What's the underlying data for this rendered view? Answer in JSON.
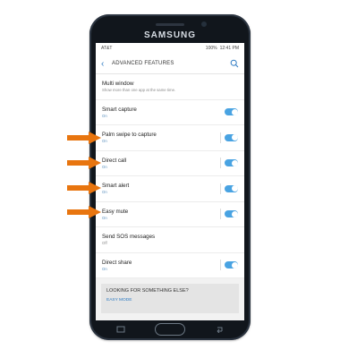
{
  "device": {
    "brand": "SAMSUNG"
  },
  "status_bar": {
    "carrier": "AT&T",
    "battery": "100%",
    "time": "12:41 PM"
  },
  "app_bar": {
    "title": "ADVANCED FEATURES",
    "back_icon": "back-arrow-icon",
    "search_icon": "search-icon"
  },
  "settings": [
    {
      "title": "Multi window",
      "subtitle": "Show more than one app at the same time.",
      "toggle": null
    },
    {
      "title": "Smart capture",
      "subtitle": "On",
      "toggle": true
    },
    {
      "title": "Palm swipe to capture",
      "subtitle": "On",
      "toggle": true
    },
    {
      "title": "Direct call",
      "subtitle": "On",
      "toggle": true
    },
    {
      "title": "Smart alert",
      "subtitle": "On",
      "toggle": true
    },
    {
      "title": "Easy mute",
      "subtitle": "On",
      "toggle": true
    },
    {
      "title": "Send SOS messages",
      "subtitle": "Off",
      "toggle": null
    },
    {
      "title": "Direct share",
      "subtitle": "On",
      "toggle": true
    }
  ],
  "help_card": {
    "title": "LOOKING FOR SOMETHING ELSE?",
    "link": "EASY MODE"
  },
  "annotations": {
    "arrow_color": "#e8750f",
    "arrow_rows": [
      "Palm swipe to capture",
      "Direct call",
      "Smart alert",
      "Easy mute"
    ]
  },
  "colors": {
    "accent": "#49a3e2",
    "link": "#2b79c2"
  }
}
